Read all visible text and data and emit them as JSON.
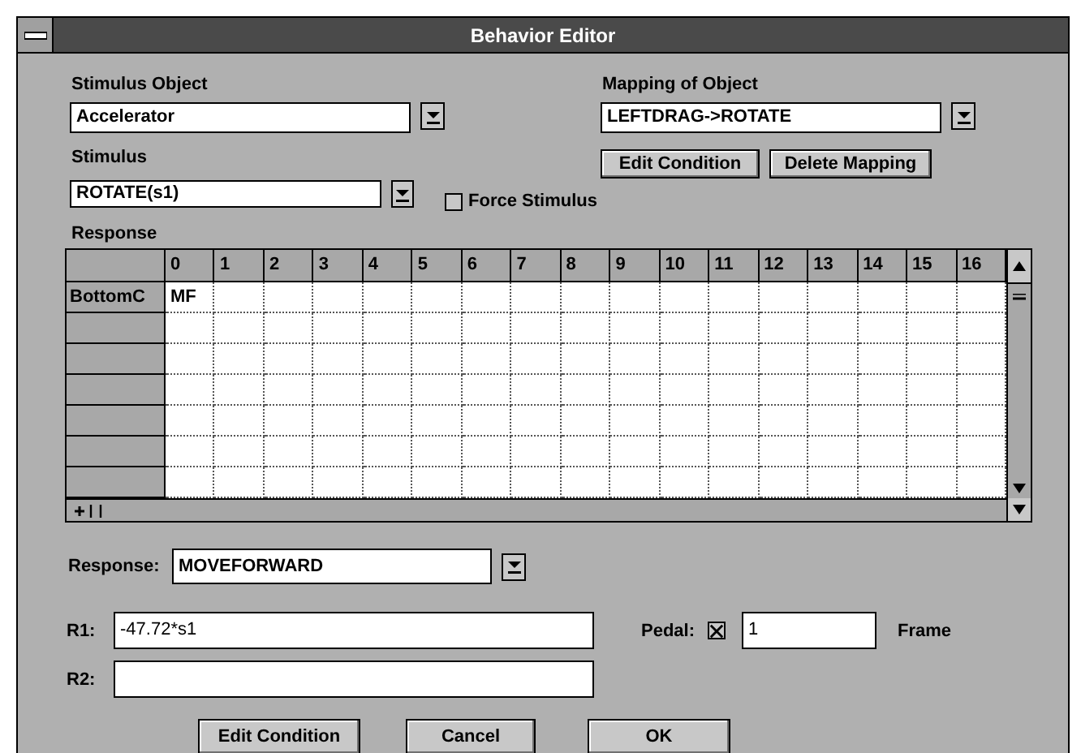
{
  "window": {
    "title": "Behavior Editor"
  },
  "stimulus_object": {
    "label": "Stimulus Object",
    "value": "Accelerator"
  },
  "mapping_of_object": {
    "label": "Mapping of Object",
    "value": "LEFTDRAG->ROTATE"
  },
  "mapping_buttons": [
    "Edit Condition",
    "Delete Mapping"
  ],
  "stimulus": {
    "label": "Stimulus",
    "value": "ROTATE(s1)"
  },
  "force_stimulus": {
    "label": "Force Stimulus",
    "checked": false
  },
  "response_grid": {
    "label": "Response",
    "columns": [
      "0",
      "1",
      "2",
      "3",
      "4",
      "5",
      "6",
      "7",
      "8",
      "9",
      "10",
      "11",
      "12",
      "13",
      "14",
      "15",
      "16"
    ],
    "rows": [
      {
        "header": "BottomC",
        "cells": [
          "MF"
        ]
      }
    ]
  },
  "response": {
    "label": "Response:",
    "value": "MOVEFORWARD"
  },
  "r1": {
    "label": "R1:",
    "value": "-47.72*s1"
  },
  "pedal": {
    "label": "Pedal:",
    "checked": true,
    "value": "1",
    "unit": "Frame"
  },
  "r2": {
    "label": "R2:"
  },
  "buttons": [
    "Edit Condition",
    "Cancel",
    "OK"
  ]
}
